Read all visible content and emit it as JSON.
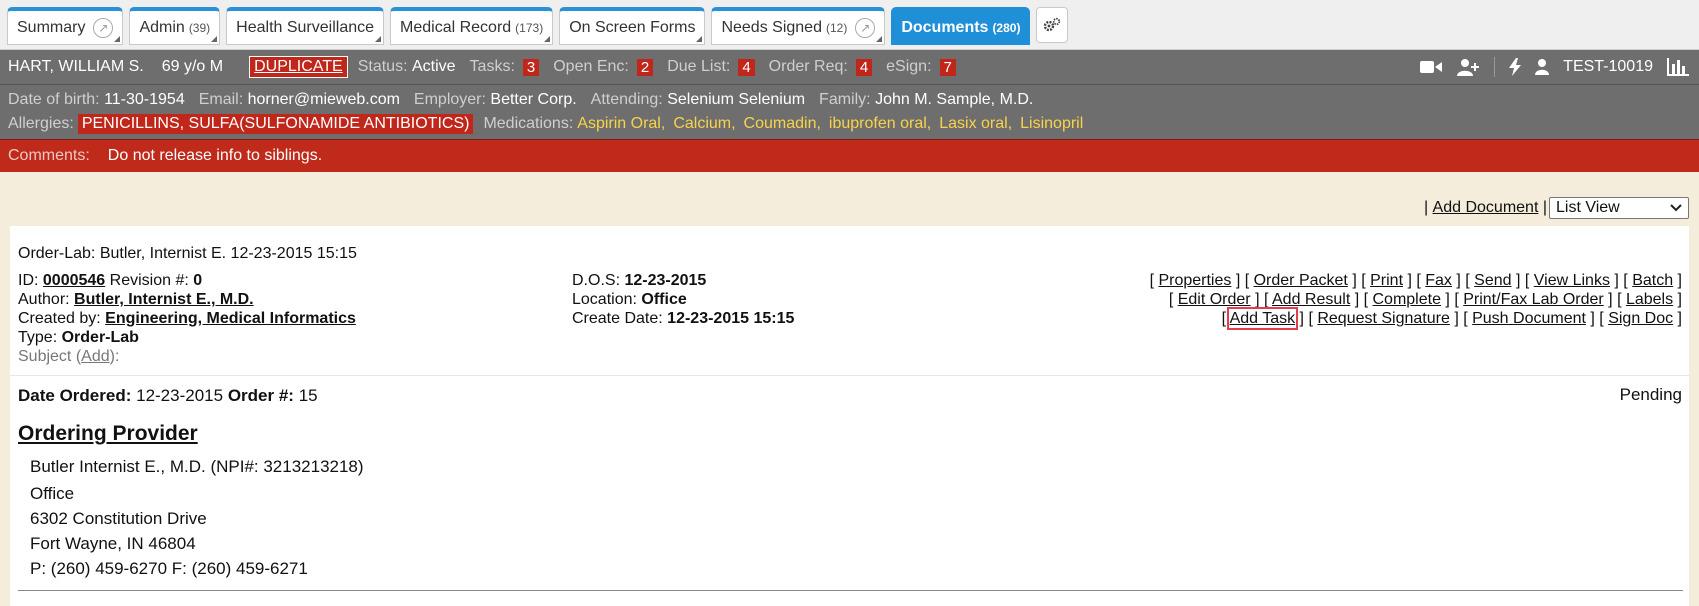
{
  "tabs": [
    {
      "label": "Summary",
      "count": "",
      "ext": true
    },
    {
      "label": "Admin",
      "count": "(39)",
      "ext": false
    },
    {
      "label": "Health Surveillance",
      "count": "",
      "ext": false
    },
    {
      "label": "Medical Record",
      "count": "(173)",
      "ext": false
    },
    {
      "label": "On Screen Forms",
      "count": "",
      "ext": false
    },
    {
      "label": "Needs Signed",
      "count": "(12)",
      "ext": true
    },
    {
      "label": "Documents",
      "count": "(280)",
      "ext": false,
      "active": true
    }
  ],
  "patient": {
    "name": "HART, WILLIAM S.",
    "age": "69 y/o M",
    "duplicate": "DUPLICATE",
    "status_label": "Status:",
    "status": "Active",
    "tasks_label": "Tasks:",
    "tasks": "3",
    "open_enc_label": "Open Enc:",
    "open_enc": "2",
    "due_list_label": "Due List:",
    "due_list": "4",
    "order_req_label": "Order Req:",
    "order_req": "4",
    "esign_label": "eSign:",
    "esign": "7",
    "user": "TEST-10019",
    "dob_label": "Date of birth:",
    "dob": "11-30-1954",
    "email_label": "Email:",
    "email": "horner@mieweb.com",
    "employer_label": "Employer:",
    "employer": "Better Corp.",
    "attending_label": "Attending:",
    "attending": "Selenium Selenium",
    "family_label": "Family:",
    "family": "John M. Sample, M.D.",
    "allergies_label": "Allergies:",
    "allergies": "PENICILLINS, SULFA(SULFONAMIDE ANTIBIOTICS)",
    "medications_label": "Medications:",
    "medications": [
      "Aspirin Oral,",
      "Calcium,",
      "Coumadin,",
      "ibuprofen oral,",
      "Lasix oral,",
      "Lisinopril"
    ]
  },
  "comments": {
    "label": "Comments:",
    "text": "Do not release info to siblings."
  },
  "toolbar": {
    "add_document": "Add Document",
    "view": "List View"
  },
  "doc": {
    "title": "Order-Lab: Butler, Internist E. 12-23-2015 15:15",
    "id_label": "ID:",
    "id": "0000546",
    "revision_label": "Revision #:",
    "revision": "0",
    "author_label": "Author:",
    "author": "Butler, Internist E., M.D.",
    "created_label": "Created by:",
    "created_by": "Engineering, Medical Informatics",
    "type_label": "Type:",
    "type": "Order-Lab",
    "subject_label": "Subject (",
    "subject_add": "Add",
    "subject_end": "):",
    "dos_label": "D.O.S:",
    "dos": "12-23-2015",
    "location_label": "Location:",
    "location": "Office",
    "create_date_label": "Create Date:",
    "create_date": "12-23-2015 15:15",
    "actions_row1": [
      "Properties",
      "Order Packet",
      "Print",
      "Fax",
      "Send",
      "View Links",
      "Batch"
    ],
    "actions_row2": [
      "Edit Order",
      "Add Result",
      "Complete",
      "Print/Fax Lab Order",
      "Labels"
    ],
    "actions_row3": [
      "Add Task",
      "Request Signature",
      "Push Document",
      "Sign Doc"
    ],
    "date_ordered_label": "Date Ordered:",
    "date_ordered": "12-23-2015",
    "order_no_label": "Order #:",
    "order_no": "15",
    "status": "Pending",
    "provider_heading": "Ordering Provider",
    "provider_lines": [
      "Butler Internist E., M.D. (NPI#: 3213213218)",
      "Office",
      "6302 Constitution Drive",
      "Fort Wayne, IN 46804",
      "P: (260) 459-6270 F: (260) 459-6271"
    ]
  }
}
